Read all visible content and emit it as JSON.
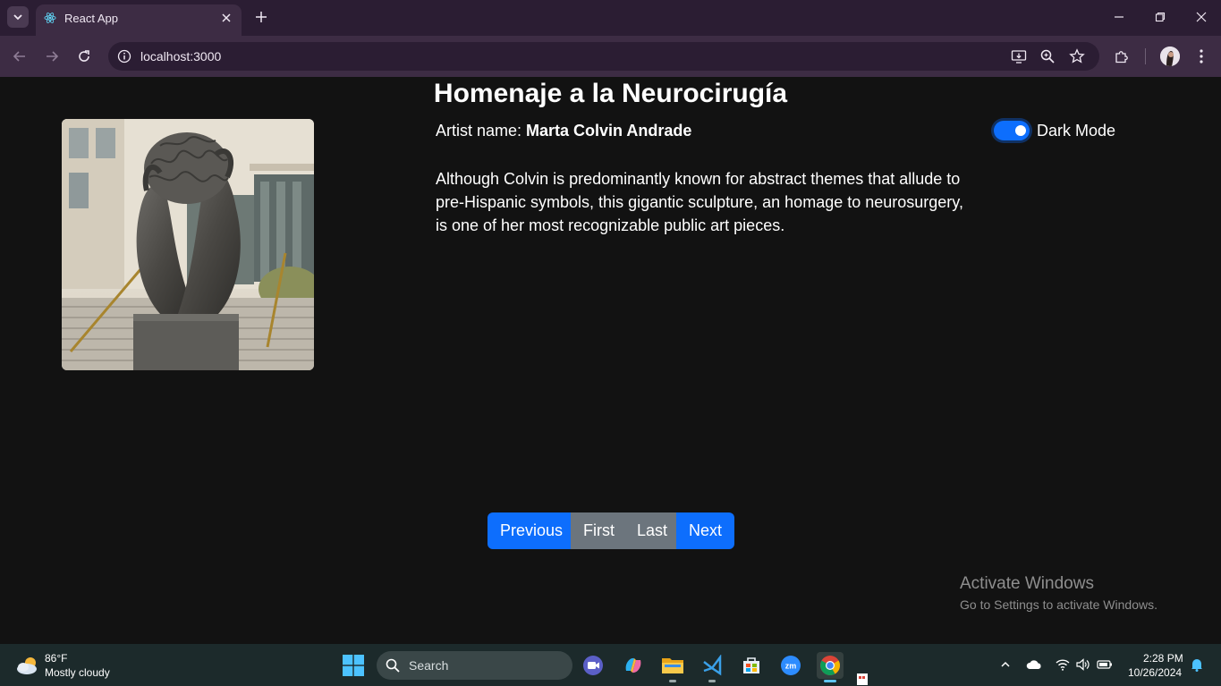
{
  "browser": {
    "tab_title": "React App",
    "url": "localhost:3000"
  },
  "page": {
    "title": "Homenaje a la Neurocirugía",
    "artist_prefix": "Artist name: ",
    "artist_name": "Marta Colvin Andrade",
    "description": "Although Colvin is predominantly known for abstract themes that allude to pre-Hispanic symbols, this gigantic sculpture, an homage to neurosurgery, is one of her most recognizable public art pieces.",
    "dark_mode_label": "Dark Mode",
    "dark_mode_on": true,
    "pager": {
      "previous": "Previous",
      "first": "First",
      "last": "Last",
      "next": "Next"
    }
  },
  "watermark": {
    "line1": "Activate Windows",
    "line2": "Go to Settings to activate Windows."
  },
  "taskbar": {
    "weather_temp": "86°F",
    "weather_desc": "Mostly cloudy",
    "search_placeholder": "Search",
    "time": "2:28 PM",
    "date": "10/26/2024"
  },
  "colors": {
    "primary": "#0d6efd",
    "secondary": "#6c757d",
    "background": "#121212",
    "chrome": "#3d2c44"
  }
}
